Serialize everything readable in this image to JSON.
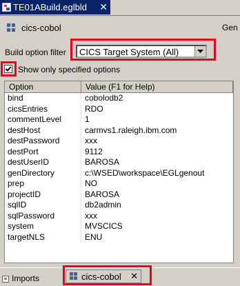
{
  "top_tab": {
    "title": "TE01ABuild.eglbld",
    "close": "✕"
  },
  "header": {
    "part_name": "cics-cobol",
    "gen_label": "Gen"
  },
  "filter": {
    "label": "Build option filter",
    "value": "CICS Target System (All)"
  },
  "checkbox": {
    "label": "Show only specified options",
    "checked": true
  },
  "table": {
    "headers": [
      "Option",
      "Value (F1 for Help)"
    ],
    "rows": [
      [
        "bind",
        "cobolodb2"
      ],
      [
        "cicsEntries",
        "RDO"
      ],
      [
        "commentLevel",
        "1"
      ],
      [
        "destHost",
        "carmvs1.raleigh.ibm.com"
      ],
      [
        "destPassword",
        "xxx"
      ],
      [
        "destPort",
        "9112"
      ],
      [
        "destUserID",
        "BAROSA"
      ],
      [
        "genDirectory",
        "c:\\WSED\\workspace\\EGLgenout"
      ],
      [
        "prep",
        "NO"
      ],
      [
        "projectID",
        "BAROSA"
      ],
      [
        "sqlID",
        "db2admin"
      ],
      [
        "sqlPassword",
        "xxx"
      ],
      [
        "system",
        "MVSCICS"
      ],
      [
        "targetNLS",
        "ENU"
      ]
    ]
  },
  "bottom_tabs": {
    "imports": "Imports",
    "part": "cics-cobol",
    "close": "✕"
  },
  "colors": {
    "highlight_red": "#e8001c",
    "active_tab": "#0a246a",
    "chrome": "#d4d0c8"
  }
}
